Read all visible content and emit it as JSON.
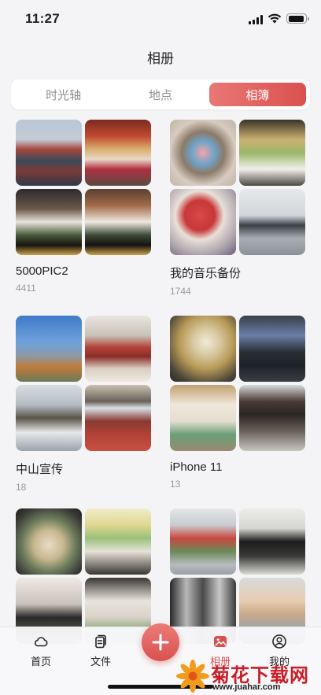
{
  "status_bar": {
    "time": "11:27"
  },
  "header": {
    "title": "相册"
  },
  "tabs": [
    {
      "label": "时光轴",
      "active": false
    },
    {
      "label": "地点",
      "active": false
    },
    {
      "label": "相簿",
      "active": true
    }
  ],
  "albums": [
    {
      "name": "5000PIC2",
      "count": "4411"
    },
    {
      "name": "我的音乐备份",
      "count": "1744"
    },
    {
      "name": "中山宣传",
      "count": "18"
    },
    {
      "name": "iPhone 11",
      "count": "13"
    },
    {
      "name": "",
      "count": ""
    },
    {
      "name": "",
      "count": ""
    }
  ],
  "tabbar": {
    "home_label": "首页",
    "files_label": "文件",
    "album_label": "相册",
    "mine_label": "我的"
  },
  "colors": {
    "accent": "#d9514f",
    "background": "#f4f4f6"
  },
  "watermark": {
    "text": "菊花下载网",
    "url": "www.juahar.com"
  }
}
